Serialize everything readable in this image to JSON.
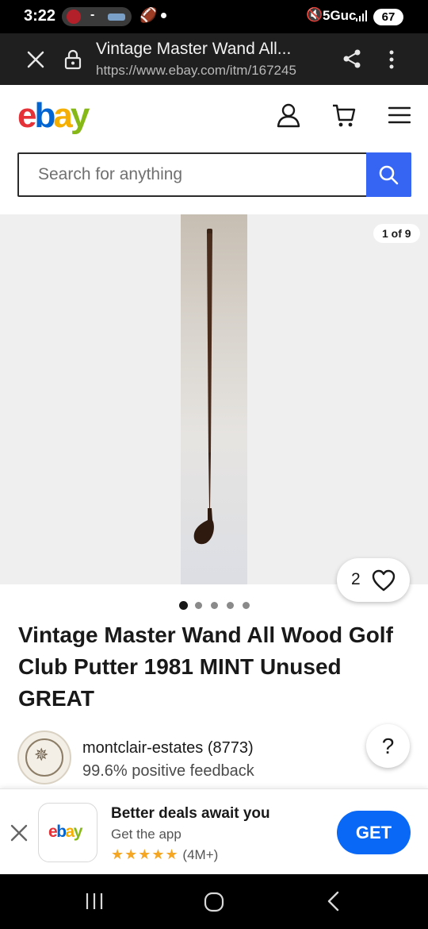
{
  "status_bar": {
    "time": "3:22",
    "notification_dash": "-",
    "network": "5Guc",
    "battery": "67"
  },
  "browser": {
    "page_title": "Vintage Master Wand All...",
    "url": "https://www.ebay.com/itm/167245"
  },
  "search": {
    "placeholder": "Search for anything"
  },
  "gallery": {
    "counter": "1 of 9",
    "favorite_count": "2",
    "dot_count": 5,
    "active_dot": 0
  },
  "listing": {
    "title": "Vintage Master Wand All Wood Golf Club Putter 1981 MINT Unused GREAT"
  },
  "seller": {
    "name": "montclair-estates (8773)",
    "feedback": "99.6% positive feedback"
  },
  "help": {
    "label": "?"
  },
  "app_banner": {
    "headline": "Better deals await you",
    "subtitle": "Get the app",
    "stars": "★★★★★",
    "rating_count": "(4M+)",
    "cta": "GET"
  },
  "logo": {
    "text_e": "e",
    "text_b": "b",
    "text_a": "a",
    "text_y": "y"
  },
  "colors": {
    "accent_blue": "#3665f3",
    "get_button": "#0968f6",
    "logo_red": "#e53238",
    "logo_blue": "#0064d2",
    "logo_yellow": "#f5af02",
    "logo_green": "#86b817"
  }
}
